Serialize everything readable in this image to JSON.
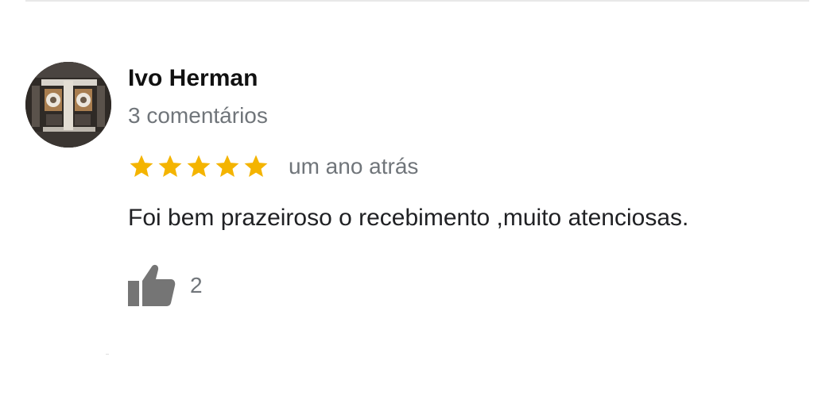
{
  "review": {
    "author_name": "Ivo Herman",
    "comment_count": "3 comentários",
    "rating": 5,
    "rating_max": 5,
    "date": "um ano atrás",
    "text": "Foi bem prazeiroso o recebimento ,muito atenciosas.",
    "like_count": "2"
  },
  "colors": {
    "star": "#f4b400",
    "secondary_text": "#70757a",
    "primary_text": "#202124",
    "like_icon": "#757575"
  },
  "icons": {
    "star": "star-icon",
    "like": "thumbs-up-icon",
    "avatar": "profile-photo"
  }
}
